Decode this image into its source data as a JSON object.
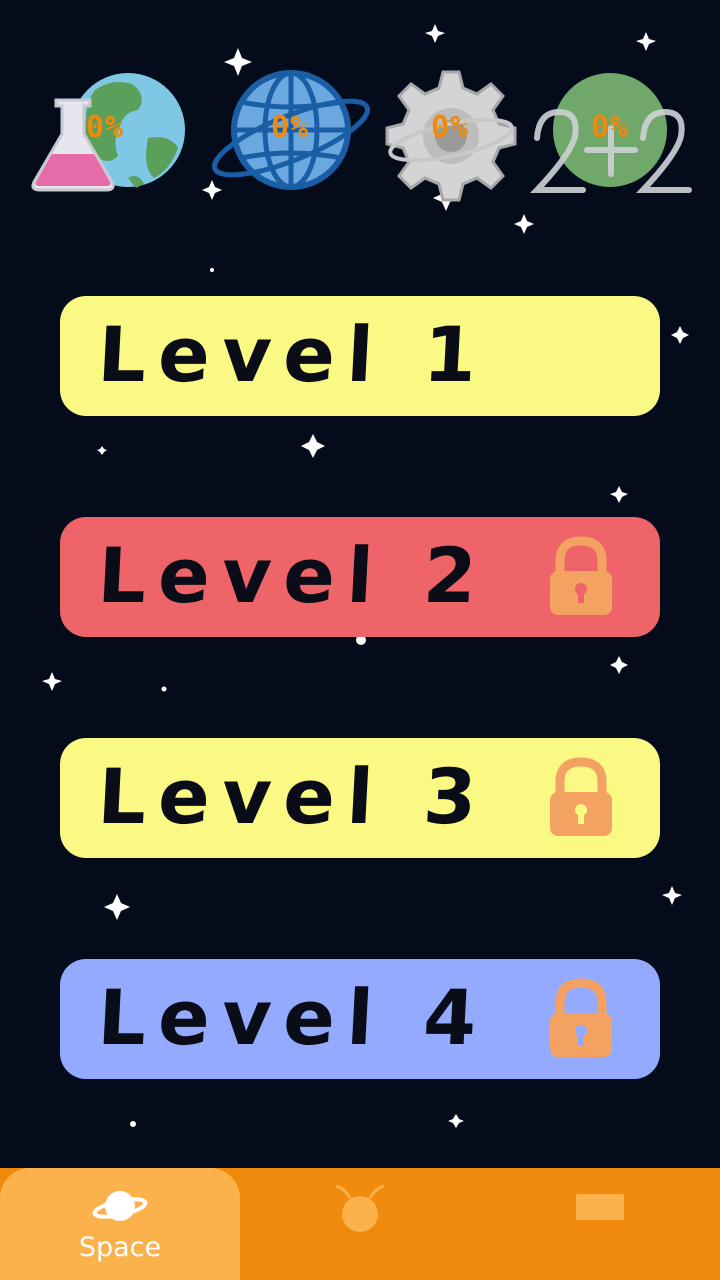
{
  "categories": [
    {
      "name": "science",
      "percent": "0%"
    },
    {
      "name": "geography",
      "percent": "0%"
    },
    {
      "name": "technology",
      "percent": "0%"
    },
    {
      "name": "math",
      "percent": "0%"
    }
  ],
  "levels": [
    {
      "label": "Level 1",
      "locked": false,
      "color": "#f9f983"
    },
    {
      "label": "Level 2",
      "locked": true,
      "color": "#ef6468"
    },
    {
      "label": "Level 3",
      "locked": true,
      "color": "#f9f983"
    },
    {
      "label": "Level 4",
      "locked": true,
      "color": "#93aaff"
    }
  ],
  "lock_color": "#f3a262",
  "tabs": [
    {
      "label": "Space",
      "icon": "planet-icon",
      "active": true
    },
    {
      "label": "",
      "icon": "alien-icon",
      "active": false
    },
    {
      "label": "",
      "icon": "card-icon",
      "active": false
    }
  ],
  "theme": {
    "accent": "#f08a0c",
    "background": "#040c1c"
  }
}
